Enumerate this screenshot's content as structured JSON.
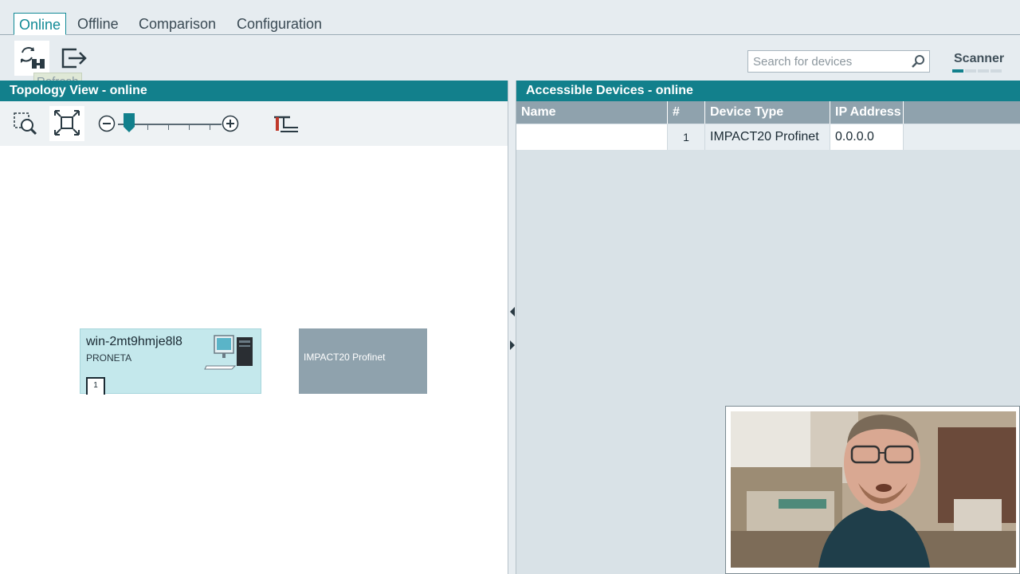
{
  "tabs": [
    {
      "label": "Online",
      "active": true
    },
    {
      "label": "Offline",
      "active": false
    },
    {
      "label": "Comparison",
      "active": false
    },
    {
      "label": "Configuration",
      "active": false
    }
  ],
  "toolbar": {
    "refresh_tooltip": "Refresh",
    "search_placeholder": "Search for devices",
    "scanner_label": "Scanner"
  },
  "topology": {
    "title": "Topology View - online",
    "zoom_level_fraction": 0.06,
    "nodes": [
      {
        "name": "win-2mt9hmje8l8",
        "type": "PRONETA",
        "port": "1"
      },
      {
        "name": "IMPACT20 Profinet"
      }
    ]
  },
  "devices": {
    "title": "Accessible Devices - online",
    "columns": [
      "Name",
      "#",
      "Device Type",
      "IP Address"
    ],
    "rows": [
      {
        "name": "",
        "index": "1",
        "device_type": "IMPACT20 Profinet",
        "ip": "0.0.0.0"
      }
    ]
  },
  "colors": {
    "accent": "#12808c",
    "tab_active": "#118a96",
    "header_gray": "#8fa2ad",
    "pc_node": "#c4e8ec"
  }
}
